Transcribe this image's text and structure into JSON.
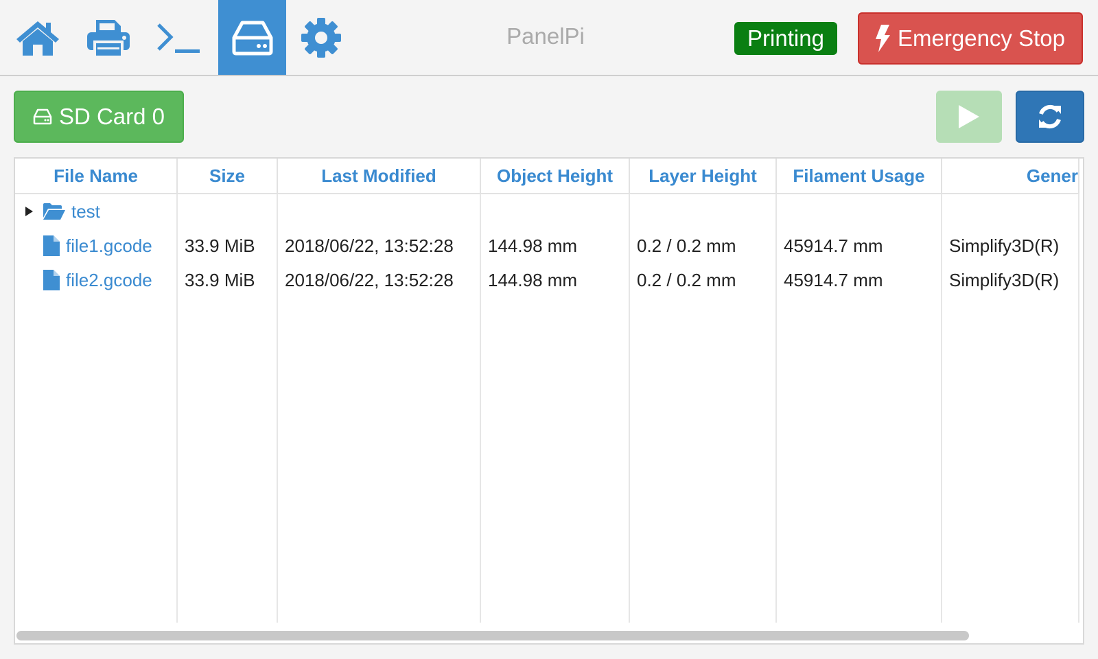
{
  "app": {
    "title": "PanelPi"
  },
  "nav": {
    "items": [
      {
        "name": "home",
        "icon": "home-icon",
        "active": false
      },
      {
        "name": "printer",
        "icon": "printer-icon",
        "active": false
      },
      {
        "name": "console",
        "icon": "terminal-icon",
        "active": false
      },
      {
        "name": "storage",
        "icon": "hdd-icon",
        "active": true
      },
      {
        "name": "settings",
        "icon": "gear-icon",
        "active": false
      }
    ]
  },
  "status": {
    "label": "Printing",
    "color": "#0a7f12"
  },
  "emergency": {
    "label": "Emergency Stop",
    "icon": "bolt-icon",
    "color": "#d9534f"
  },
  "toolbar": {
    "sd_label": "SD Card 0",
    "sd_icon": "hdd-icon",
    "play_icon": "play-icon",
    "refresh_icon": "refresh-icon"
  },
  "table": {
    "headers": [
      "File Name",
      "Size",
      "Last Modified",
      "Object Height",
      "Layer Height",
      "Filament Usage",
      "Gener"
    ],
    "folder": {
      "name": "test",
      "icon": "folder-open-icon"
    },
    "rows": [
      {
        "name": "file1.gcode",
        "size": "33.9 MiB",
        "modified": "2018/06/22, 13:52:28",
        "object_height": "144.98 mm",
        "layer_height": "0.2 / 0.2 mm",
        "filament": "45914.7 mm",
        "generator": "Simplify3D(R)"
      },
      {
        "name": "file2.gcode",
        "size": "33.9 MiB",
        "modified": "2018/06/22, 13:52:28",
        "object_height": "144.98 mm",
        "layer_height": "0.2 / 0.2 mm",
        "filament": "45914.7 mm",
        "generator": "Simplify3D(R)"
      }
    ]
  },
  "colors": {
    "accent": "#3f8fd2",
    "success": "#5cb85c",
    "primary": "#2f76b6"
  }
}
